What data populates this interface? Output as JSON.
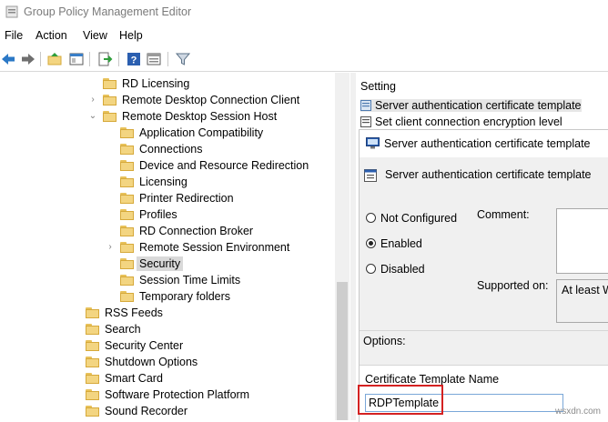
{
  "window": {
    "title": "Group Policy Management Editor"
  },
  "menu": [
    "File",
    "Action",
    "View",
    "Help"
  ],
  "tree": [
    {
      "label": "RD Licensing",
      "indent": 1,
      "chevron": ""
    },
    {
      "label": "Remote Desktop Connection Client",
      "indent": 1,
      "chevron": "›"
    },
    {
      "label": "Remote Desktop Session Host",
      "indent": 1,
      "chevron": "⌄"
    },
    {
      "label": "Application Compatibility",
      "indent": 2,
      "chevron": ""
    },
    {
      "label": "Connections",
      "indent": 2,
      "chevron": ""
    },
    {
      "label": "Device and Resource Redirection",
      "indent": 2,
      "chevron": ""
    },
    {
      "label": "Licensing",
      "indent": 2,
      "chevron": ""
    },
    {
      "label": "Printer Redirection",
      "indent": 2,
      "chevron": ""
    },
    {
      "label": "Profiles",
      "indent": 2,
      "chevron": ""
    },
    {
      "label": "RD Connection Broker",
      "indent": 2,
      "chevron": ""
    },
    {
      "label": "Remote Session Environment",
      "indent": 2,
      "chevron": "›"
    },
    {
      "label": "Security",
      "indent": 2,
      "chevron": "",
      "selected": true
    },
    {
      "label": "Session Time Limits",
      "indent": 2,
      "chevron": ""
    },
    {
      "label": "Temporary folders",
      "indent": 2,
      "chevron": ""
    },
    {
      "label": "RSS Feeds",
      "indent": 0,
      "chevron": ""
    },
    {
      "label": "Search",
      "indent": 0,
      "chevron": ""
    },
    {
      "label": "Security Center",
      "indent": 0,
      "chevron": ""
    },
    {
      "label": "Shutdown Options",
      "indent": 0,
      "chevron": ""
    },
    {
      "label": "Smart Card",
      "indent": 0,
      "chevron": ""
    },
    {
      "label": "Software Protection Platform",
      "indent": 0,
      "chevron": ""
    },
    {
      "label": "Sound Recorder",
      "indent": 0,
      "chevron": ""
    }
  ],
  "settings": {
    "header": "Setting",
    "rows": [
      "Server authentication certificate template",
      "Set client connection encryption level"
    ]
  },
  "dialog": {
    "title": "Server authentication certificate template",
    "subtitle": "Server authentication certificate template",
    "options": [
      "Not Configured",
      "Enabled",
      "Disabled"
    ],
    "selected_option": "Enabled",
    "comment_label": "Comment:",
    "supported_label": "Supported on:",
    "supported_value": "At least W",
    "options_label": "Options:",
    "field_label": "Certificate Template Name",
    "field_value": "RDPTemplate"
  },
  "watermark": "wsxdn.com",
  "colors": {
    "highlight": "#d42121",
    "folder": "#f3d581",
    "selection": "#d9d9d9"
  }
}
